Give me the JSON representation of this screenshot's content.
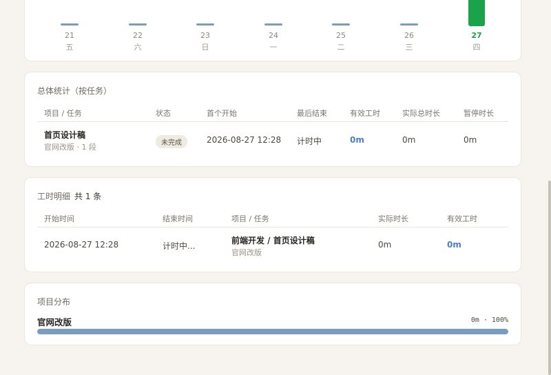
{
  "week_chart": {
    "days": [
      {
        "date": "21",
        "weekday": "五",
        "active": false
      },
      {
        "date": "22",
        "weekday": "六",
        "active": false
      },
      {
        "date": "23",
        "weekday": "日",
        "active": false
      },
      {
        "date": "24",
        "weekday": "一",
        "active": false
      },
      {
        "date": "25",
        "weekday": "二",
        "active": false
      },
      {
        "date": "26",
        "weekday": "三",
        "active": false
      },
      {
        "date": "27",
        "weekday": "四",
        "active": true
      }
    ],
    "colors": {
      "bar": "#7a9cc0",
      "active": "#1aa34a"
    }
  },
  "summary": {
    "title": "总体统计（按任务）",
    "headers": [
      "项目 / 任务",
      "状态",
      "首个开始",
      "最后结束",
      "有效工时",
      "实际总时长",
      "暂停时长"
    ],
    "row": {
      "task": "首页设计稿",
      "sub": "官网改版 · 1 段",
      "status": "未完成",
      "first_start": "2026-08-27 12:28",
      "last_end": "计时中",
      "effective": "0m",
      "actual": "0m",
      "paused": "0m"
    }
  },
  "detail": {
    "title": "工时明细",
    "count": "共 1 条",
    "headers": [
      "开始时间",
      "结束时间",
      "项目 / 任务",
      "实际时长",
      "有效工时"
    ],
    "row": {
      "start": "2026-08-27 12:28",
      "end": "计时中...",
      "task": "前端开发 / 首页设计稿",
      "project": "官网改版",
      "actual": "0m",
      "effective": "0m"
    }
  },
  "distribution": {
    "title": "项目分布",
    "items": [
      {
        "name": "官网改版",
        "stats": "0m · 100%",
        "fraction": 1.0
      }
    ]
  }
}
